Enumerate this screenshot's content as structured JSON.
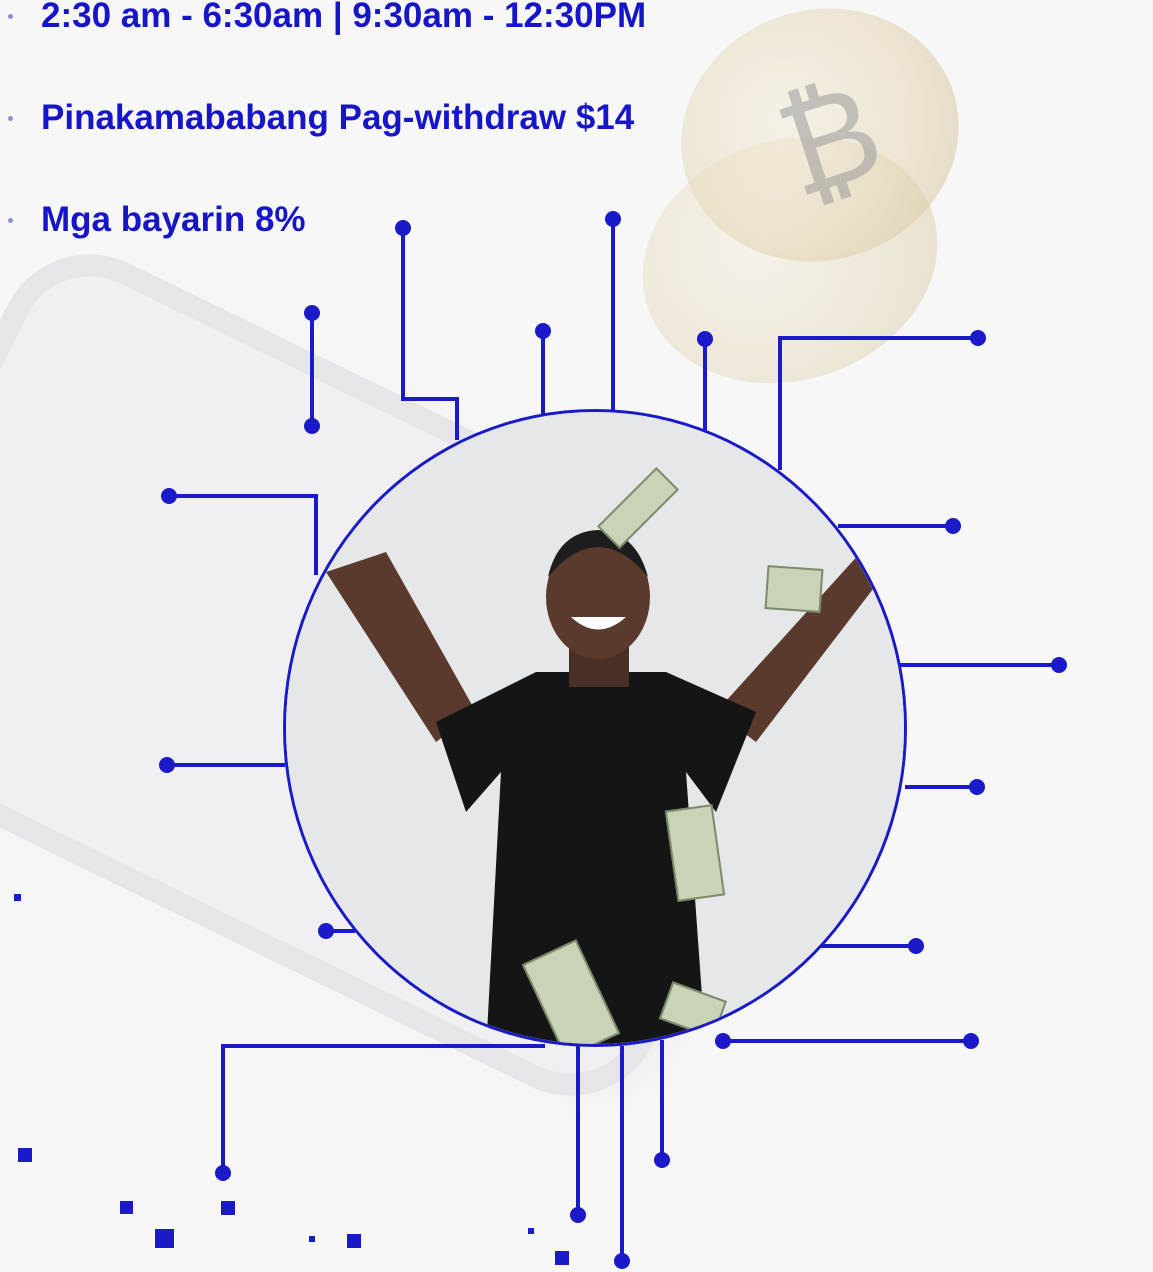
{
  "bullets": [
    {
      "text": "2:30 am - 6:30am | 9:30am - 12:30PM"
    },
    {
      "text": "Pinakamababang Pag-withdraw $14"
    },
    {
      "text": "Mga bayarin 8%"
    }
  ],
  "colors": {
    "accent": "#1616c8",
    "line": "#1a1ac8",
    "bullet_dot": "#8c8ed8"
  },
  "icons": {
    "background_coin": "bitcoin-coin-icon",
    "bullet": "bullet-dot-icon"
  }
}
